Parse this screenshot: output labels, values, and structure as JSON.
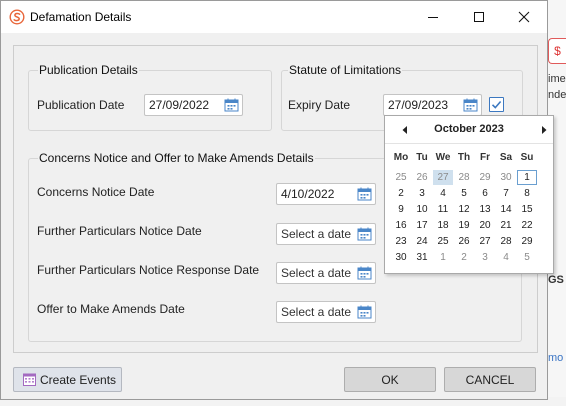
{
  "window": {
    "title": "Defamation Details",
    "controls": {
      "minimize": "minimize-icon",
      "maximize": "maximize-icon",
      "close": "close-icon"
    }
  },
  "publication": {
    "title": "Publication Details",
    "date_label": "Publication Date",
    "date_value": "27/09/2022"
  },
  "statute": {
    "title": "Statute of Limitations",
    "expiry_label": "Expiry Date",
    "expiry_value": "27/09/2023",
    "checkbox_checked": true
  },
  "concerns": {
    "title": "Concerns Notice and Offer to Make Amends Details",
    "fields": [
      {
        "label": "Concerns Notice Date",
        "value": "4/10/2022"
      },
      {
        "label": "Further Particulars Notice Date",
        "value": "Select a date"
      },
      {
        "label": "Further Particulars Notice Response Date",
        "value": "Select a date"
      },
      {
        "label": "Offer to Make Amends Date",
        "value": "Select a date"
      }
    ]
  },
  "buttons": {
    "create_events": "Create Events",
    "ok": "OK",
    "cancel": "CANCEL"
  },
  "calendar": {
    "month_label": "October 2023",
    "weekdays": [
      "Mo",
      "Tu",
      "We",
      "Th",
      "Fr",
      "Sa",
      "Su"
    ],
    "weeks": [
      [
        "25",
        "26",
        "27",
        "28",
        "29",
        "30",
        "1"
      ],
      [
        "2",
        "3",
        "4",
        "5",
        "6",
        "7",
        "8"
      ],
      [
        "9",
        "10",
        "11",
        "12",
        "13",
        "14",
        "15"
      ],
      [
        "16",
        "17",
        "18",
        "19",
        "20",
        "21",
        "22"
      ],
      [
        "23",
        "24",
        "25",
        "26",
        "27",
        "28",
        "29"
      ],
      [
        "30",
        "31",
        "1",
        "2",
        "3",
        "4",
        "5"
      ]
    ],
    "selected_day": "27",
    "highlighted_day": "1"
  },
  "background": {
    "snippets": [
      "ime",
      "nde",
      "GS",
      "mo"
    ]
  },
  "colors": {
    "accent": "#3c78c0",
    "app_icon": "#e8663a",
    "selected_day_bg": "#cfe0ee"
  }
}
